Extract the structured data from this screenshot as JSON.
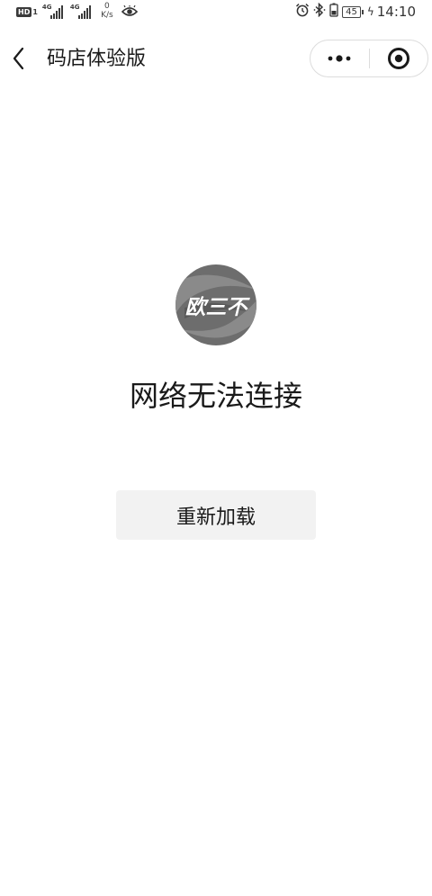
{
  "status_bar": {
    "hd_label": "HD",
    "sim_number": "1",
    "signal_1_type": "4G",
    "signal_2_type": "4G",
    "speed_value": "0",
    "speed_unit": "K/s",
    "battery_level": "45",
    "time": "14:10",
    "icons": [
      "eye-icon",
      "alarm-icon",
      "bluetooth-icon",
      "battery-icon",
      "charging-icon"
    ]
  },
  "nav": {
    "title": "码店体验版",
    "icons": [
      "back-arrow-icon",
      "more-dots-icon",
      "target-close-icon"
    ]
  },
  "main": {
    "logo_text": "欧三不",
    "error_message": "网络无法连接",
    "reload_label": "重新加载"
  },
  "colors": {
    "background": "#ffffff",
    "text": "#1a1a1a",
    "reload_button_bg": "#f2f2f2",
    "logo_gray": "#6d6d6d"
  }
}
